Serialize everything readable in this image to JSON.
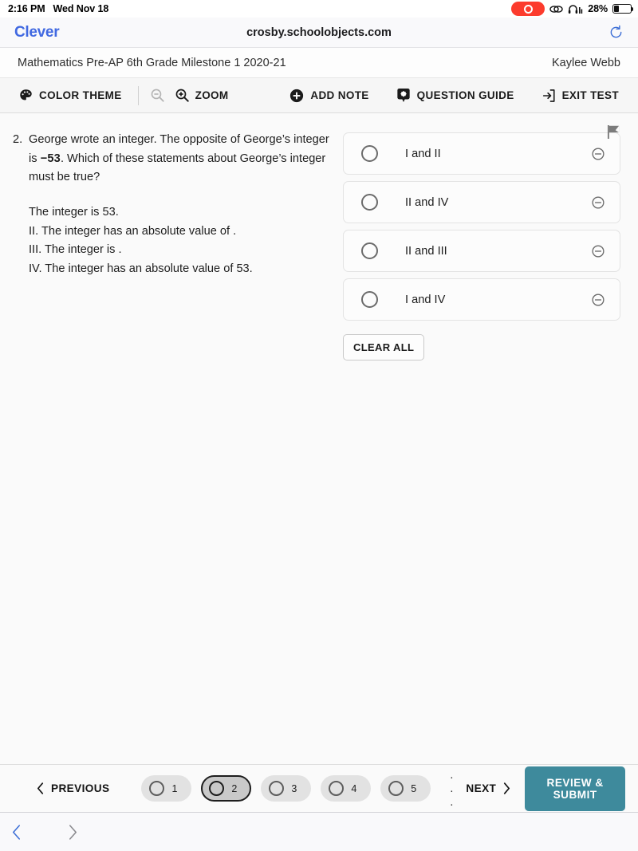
{
  "status_bar": {
    "time": "2:16 PM",
    "date": "Wed Nov 18",
    "recording_icon": "record-indicator",
    "screen_mirror_icon": "screen-mirroring-icon",
    "headphones_icon": "headphones-icon",
    "battery_percent": "28%",
    "battery_level": 28
  },
  "browser": {
    "logo_text": "Clever",
    "logo_color": "#4169e1",
    "url": "crosby.schoolobjects.com",
    "reload_icon": "reload-icon"
  },
  "test_header": {
    "title": "Mathematics Pre-AP 6th Grade Milestone 1 2020-21",
    "student": "Kaylee Webb"
  },
  "toolbar": {
    "color_theme": "COLOR THEME",
    "zoom_out_icon": "zoom-out-icon",
    "zoom_in_icon": "zoom-in-icon",
    "zoom": "ZOOM",
    "add_note": "ADD NOTE",
    "question_guide": "QUESTION GUIDE",
    "exit_test": "EXIT TEST"
  },
  "question": {
    "number": "2.",
    "text_part1": "George wrote an integer. The opposite of George’s integer is ",
    "math_value": "−53",
    "text_part2": ". Which of these statements about George’s integer must be true?",
    "statements": [
      "The integer is 53.",
      "II. The integer has an absolute value of  .",
      "III. The integer is .",
      "IV. The integer has an absolute value of 53."
    ],
    "flag_icon": "flag-icon"
  },
  "answers": {
    "options": [
      {
        "label": "I and II",
        "selected": false,
        "strike_icon": "strikethrough-icon"
      },
      {
        "label": "II and IV",
        "selected": false,
        "strike_icon": "strikethrough-icon"
      },
      {
        "label": "II and III",
        "selected": false,
        "strike_icon": "strikethrough-icon"
      },
      {
        "label": "I and IV",
        "selected": false,
        "strike_icon": "strikethrough-icon"
      }
    ],
    "clear_all": "CLEAR ALL"
  },
  "bottom_nav": {
    "previous": "PREVIOUS",
    "next": "NEXT",
    "pages": [
      {
        "num": "1",
        "current": false
      },
      {
        "num": "2",
        "current": true
      },
      {
        "num": "3",
        "current": false
      },
      {
        "num": "4",
        "current": false
      },
      {
        "num": "5",
        "current": false
      }
    ],
    "ellipsis": ". . .",
    "submit": "REVIEW & SUBMIT",
    "submit_color": "#3e8a9c"
  },
  "safari_bottom": {
    "back_icon": "chevron-left-icon",
    "forward_icon": "chevron-right-icon"
  }
}
